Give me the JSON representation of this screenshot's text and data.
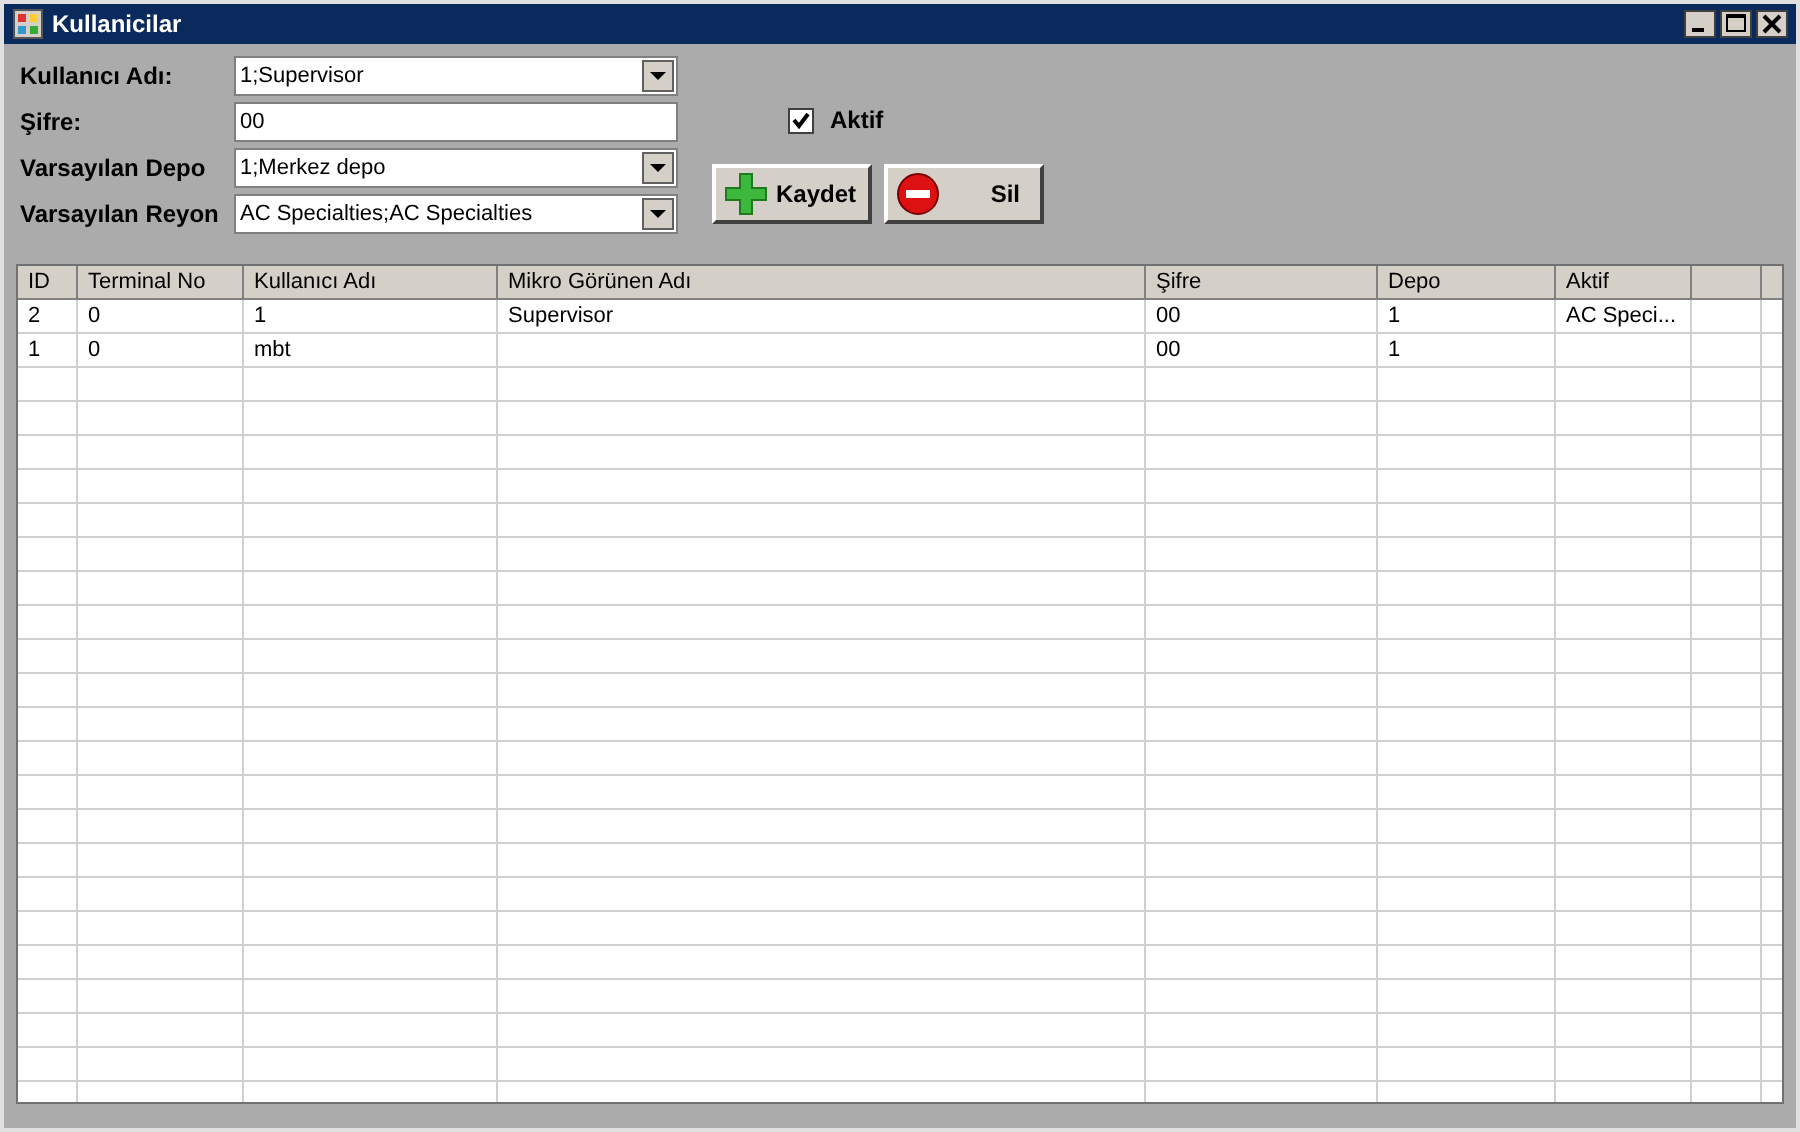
{
  "window": {
    "title": "Kullanicilar"
  },
  "form": {
    "fields": [
      {
        "label": "Kullanıcı Adı:",
        "kind": "combo",
        "value": "1;Supervisor"
      },
      {
        "label": "Şifre:",
        "kind": "text",
        "value": "00"
      },
      {
        "label": "Varsayılan Depo",
        "kind": "combo",
        "value": "1;Merkez depo"
      },
      {
        "label": "Varsayılan Reyon",
        "kind": "combo",
        "value": "AC Specialties;AC Specialties"
      }
    ],
    "active": {
      "label": "Aktif",
      "checked": true
    },
    "buttons": [
      {
        "label": "Kaydet",
        "kind": "add"
      },
      {
        "label": "Sil",
        "kind": "delete"
      }
    ]
  },
  "table": {
    "columns": [
      "ID",
      "Terminal No",
      "Kullanıcı Adı",
      "Mikro Görünen Adı",
      "Şifre",
      "Depo",
      "Aktif"
    ],
    "rows": [
      [
        "2",
        "0",
        "1",
        "Supervisor",
        "00",
        "1",
        "AC Speci..."
      ],
      [
        "1",
        "0",
        "mbt",
        null,
        "00",
        "1",
        null
      ]
    ]
  }
}
